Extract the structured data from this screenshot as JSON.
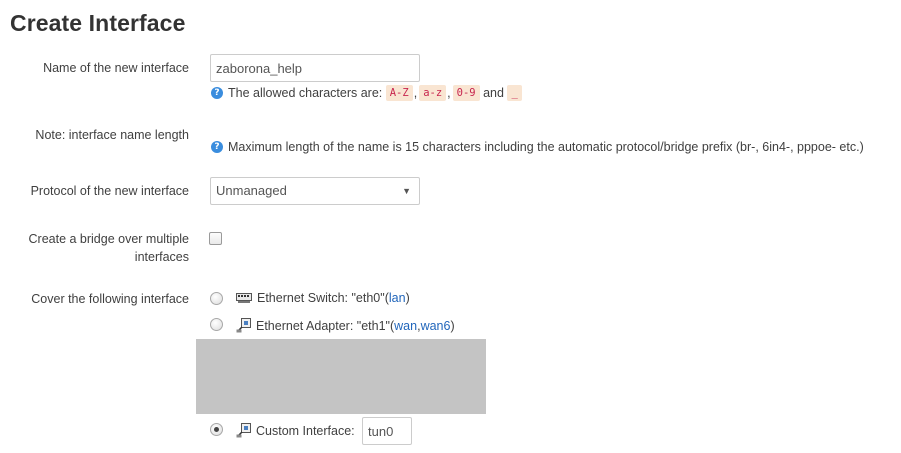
{
  "page": {
    "title": "Create Interface"
  },
  "fields": {
    "name": {
      "label": "Name of the new interface",
      "value": "zaborona_help",
      "help_prefix": "The allowed characters are:",
      "chars": [
        "A-Z",
        "a-z",
        "0-9",
        "_"
      ],
      "and": "and"
    },
    "note": {
      "label": "Note: interface name length",
      "help": "Maximum length of the name is 15 characters including the automatic protocol/bridge prefix (br-, 6in4-, pppoe- etc.)"
    },
    "protocol": {
      "label": "Protocol of the new interface",
      "selected": "Unmanaged"
    },
    "bridge": {
      "label_line1": "Create a bridge over multiple",
      "label_line2": "interfaces",
      "checked": false
    },
    "cover": {
      "label": "Cover the following interface",
      "options": [
        {
          "text": "Ethernet Switch: \"eth0\"",
          "open": " (",
          "links": [
            "lan"
          ],
          "close": ")",
          "icon": "ethernet-switch-icon",
          "checked": false
        },
        {
          "text": "Ethernet Adapter: \"eth1\"",
          "open": " (",
          "links": [
            "wan",
            "wan6"
          ],
          "sep": ", ",
          "close": ")",
          "icon": "ethernet-adapter-icon",
          "checked": false
        }
      ],
      "custom": {
        "text": "Custom Interface:",
        "value": "tun0",
        "icon": "ethernet-adapter-icon",
        "checked": true
      }
    }
  },
  "colors": {
    "link": "#2266bb",
    "code_bg": "#f9e5d2",
    "code_fg": "#c7254e",
    "help_icon": "#3a8dde",
    "redacted": "#c4c4c4"
  }
}
